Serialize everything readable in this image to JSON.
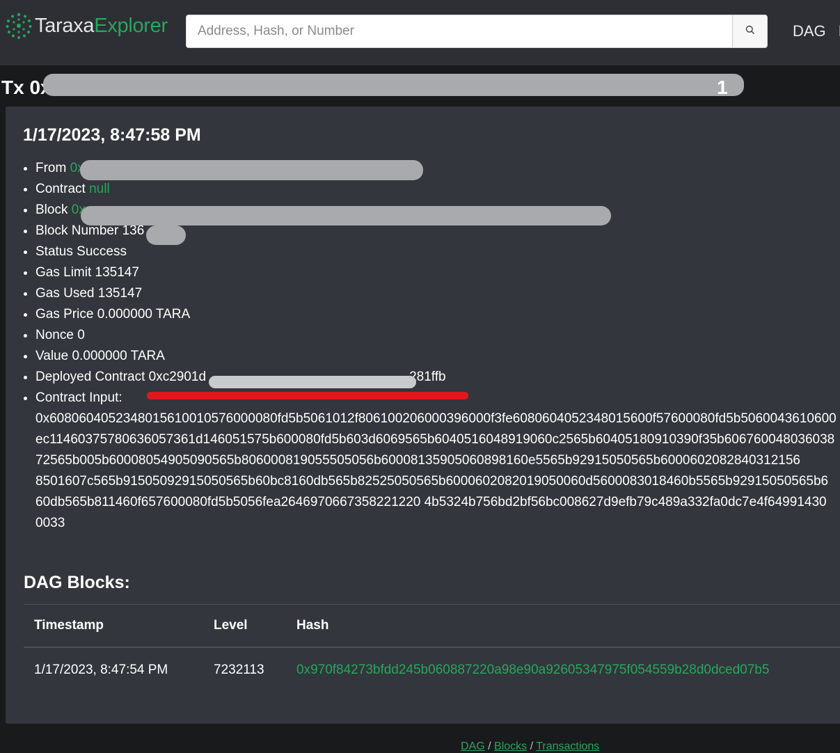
{
  "brand": {
    "name_part1": "Taraxa",
    "name_part2": "Explorer"
  },
  "search": {
    "placeholder": "Address, Hash, or Number"
  },
  "nav": {
    "dag": "DAG",
    "next_partial": "B"
  },
  "tx": {
    "title_prefix": "Tx 0x",
    "title_suffix": "1"
  },
  "details": {
    "date": "1/17/2023, 8:47:58 PM",
    "from_label": "From",
    "from_value": "0x",
    "contract_label": "Contract",
    "contract_value": "null",
    "block_label": "Block",
    "block_value": "0x",
    "block_number_label": "Block Number",
    "block_number_value": "136",
    "status_label": "Status",
    "status_value": "Success",
    "gas_limit_label": "Gas Limit",
    "gas_limit_value": "135147",
    "gas_used_label": "Gas Used",
    "gas_used_value": "135147",
    "gas_price_label": "Gas Price",
    "gas_price_value": "0.000000 TARA",
    "nonce_label": "Nonce",
    "nonce_value": "0",
    "value_label": "Value",
    "value_value": "0.000000 TARA",
    "deployed_label": "Deployed Contract",
    "deployed_prefix": "0xc2901d",
    "deployed_suffix": "281ffb",
    "input_label": "Contract Input:",
    "input_lines": [
      "0x6080604052348015610010576000080fd5b5061012f806100206000396000f3fe6080604052348015600f57600080fd5b5060043610600",
      "ec11460375780636057361d146051575b600080fd5b603d6069565b6040516048919060c2565b60405180910390f35b606760048036038",
      "72565b005b60008054905090565b806000819055505056b60008135905060898160e5565b92915050565b6000602082840312156",
      "8501607c565b91505092915050565b60bc8160db565b82525050565b6000602082019050060d5600083018460b5565b92915050565b6",
      "60db565b811460f657600080fd5b5056fea2646970667358221220 4b5324b756bd2bf56bc008627d9efb79c489a332fa0dc7e4f64991430",
      "0033"
    ]
  },
  "dag": {
    "heading": "DAG Blocks:",
    "columns": [
      "Timestamp",
      "Level",
      "Hash"
    ],
    "rows": [
      {
        "timestamp": "1/17/2023, 8:47:54 PM",
        "level": "7232113",
        "hash": "0x970f84273bfdd245b060887220a98e90a92605347975f054559b28d0dced07b5"
      }
    ]
  },
  "footer": {
    "link1": "DAG",
    "sep": "/",
    "link2": "Blocks",
    "link3": "Transactions"
  },
  "colors": {
    "accent_green": "#27a65d",
    "navbar_bg": "#2d2f34",
    "card_bg": "#33363c",
    "page_bg": "#191a1c",
    "annotation_red": "#e0181e"
  }
}
